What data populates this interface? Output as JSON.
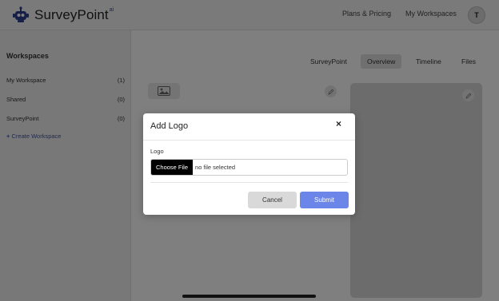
{
  "header": {
    "brand": "SurveyPoint",
    "brand_sup": "ai",
    "nav": [
      "Plans & Pricing",
      "My Workspaces"
    ],
    "avatar_initial": "T"
  },
  "sidebar": {
    "title": "Workspaces",
    "items": [
      {
        "label": "My Workspace",
        "count": "(1)"
      },
      {
        "label": "Shared",
        "count": "(0)"
      },
      {
        "label": "SurveyPoint",
        "count": "(0)"
      }
    ],
    "create_label": "Create Workspace"
  },
  "tabs": [
    "SurveyPoint",
    "Overview",
    "Timeline",
    "Files"
  ],
  "active_tab": "Overview",
  "modal": {
    "title": "Add Logo",
    "close_glyph": "×",
    "field_label": "Logo",
    "file_button": "Choose File",
    "file_status": "no file selected",
    "cancel_label": "Cancel",
    "submit_label": "Submit"
  },
  "colors": {
    "accent": "#6b85e8",
    "link": "#3a55b8",
    "overlay": "rgba(0,0,0,0.5)"
  },
  "icons": [
    "robot-logo-icon",
    "image-icon",
    "pencil-icon",
    "plus-icon",
    "close-icon"
  ]
}
